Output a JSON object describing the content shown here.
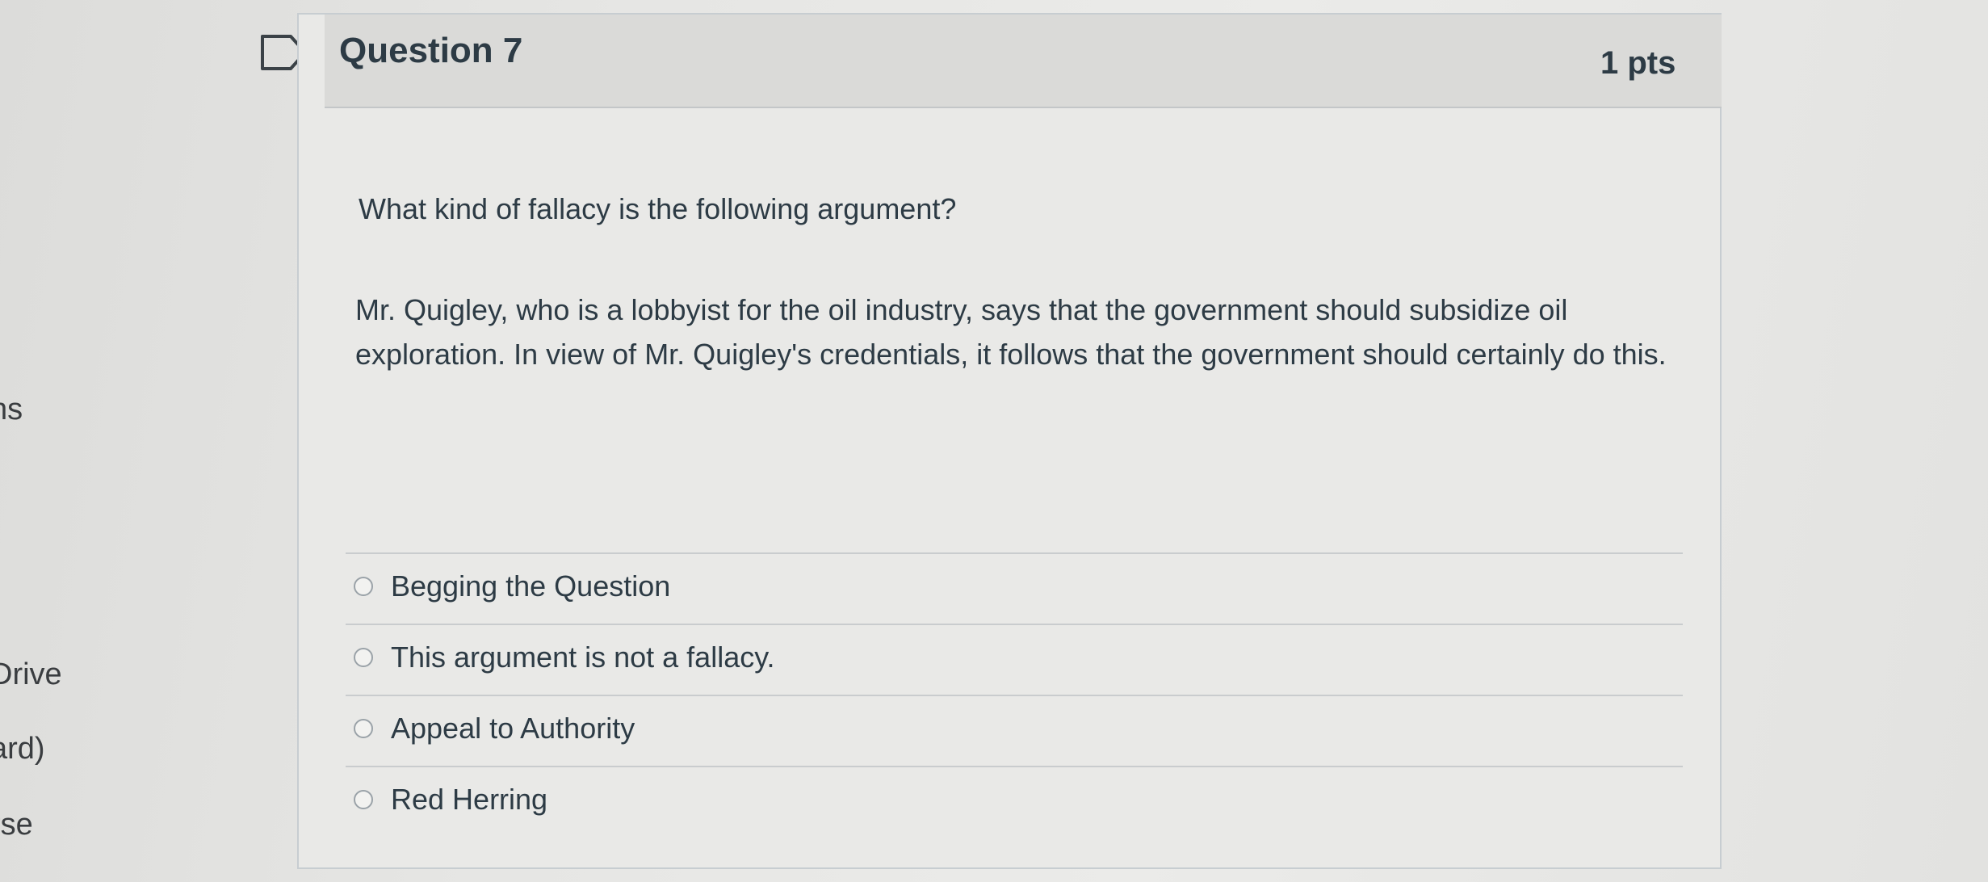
{
  "sidebar": {
    "items": [
      {
        "label": "ns"
      },
      {
        "label": "Drive"
      },
      {
        "label": "ard)"
      },
      {
        "label": "rse"
      }
    ]
  },
  "question": {
    "title": "Question 7",
    "points": "1 pts",
    "prompt": "What kind of fallacy is the following argument?",
    "body": "Mr. Quigley, who is a lobbyist for the oil industry, says that the government should subsidize oil exploration. In view of Mr. Quigley's credentials, it follows that the government should certainly do this.",
    "answers": [
      {
        "label": "Begging the Question"
      },
      {
        "label": "This argument is not a fallacy."
      },
      {
        "label": "Appeal to Authority"
      },
      {
        "label": "Red Herring"
      }
    ]
  },
  "icons": {
    "flag": "flag-icon",
    "radio": "radio-button"
  }
}
